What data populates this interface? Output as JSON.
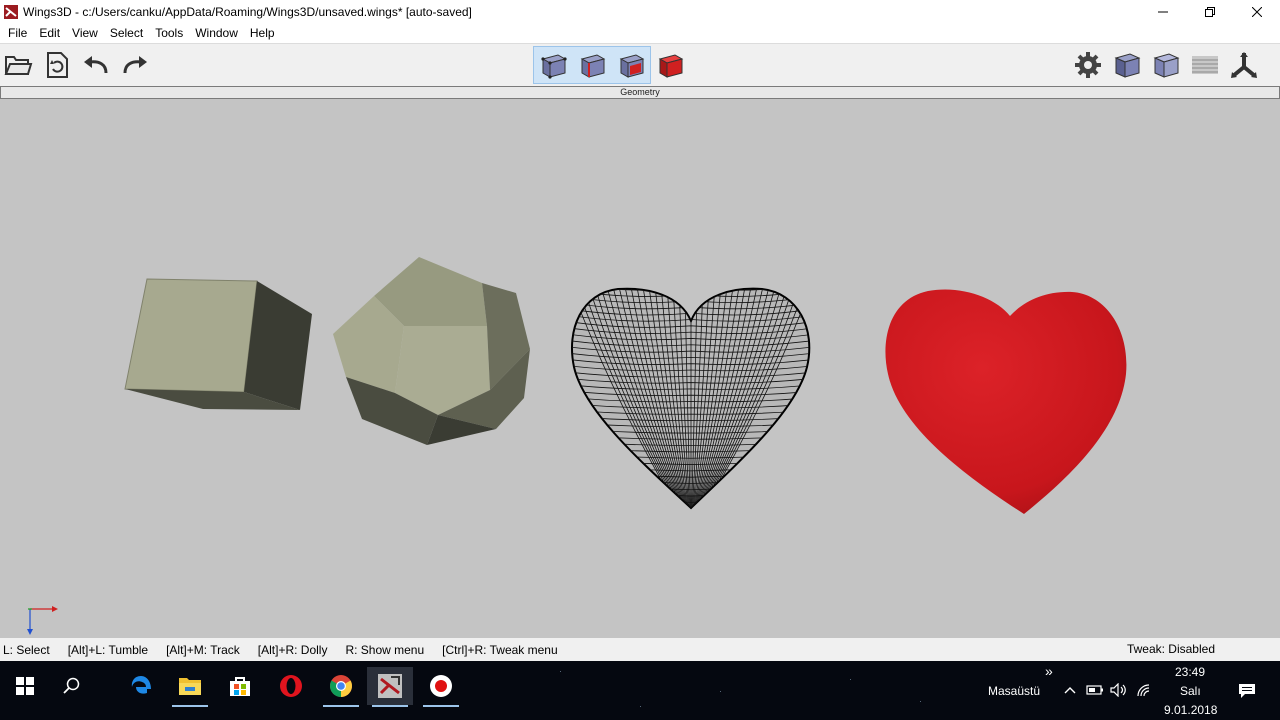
{
  "window": {
    "title": "Wings3D - c:/Users/canku/AppData/Roaming/Wings3D/unsaved.wings* [auto-saved]",
    "icon": "wings3d-app-icon",
    "controls": [
      "minimize-icon",
      "restore-icon",
      "close-icon"
    ]
  },
  "menubar": {
    "items": [
      "File",
      "Edit",
      "View",
      "Select",
      "Tools",
      "Window",
      "Help"
    ]
  },
  "toolbar": {
    "left_icons": [
      "open-folder-icon",
      "save-icon",
      "undo-icon",
      "redo-icon"
    ],
    "selection_modes": [
      "vertex-mode-icon",
      "edge-mode-icon",
      "face-mode-icon",
      "body-mode-icon"
    ],
    "right_icons": [
      "gear-icon",
      "smooth-preview-icon",
      "wireframe-icon",
      "ground-plane-icon",
      "axes-icon"
    ]
  },
  "geometry_bar": {
    "label": "Geometry"
  },
  "viewport": {
    "objects": [
      "cube",
      "dodecahedron",
      "wireframe-heart",
      "red-heart"
    ],
    "colors": {
      "background": "#c4c4c4",
      "object_light": "#a7a98f",
      "object_dark": "#3a3c33",
      "heart_red": "#c8161c"
    }
  },
  "statusbar": {
    "hints": [
      "L: Select",
      "[Alt]+L: Tumble",
      "[Alt]+M: Track",
      "[Alt]+R: Dolly",
      "R: Show menu",
      "[Ctrl]+R: Tweak menu"
    ],
    "tweak": "Tweak: Disabled"
  },
  "taskbar": {
    "apps": [
      "windows-start-icon",
      "search-icon",
      "edge-icon",
      "file-explorer-icon",
      "store-icon",
      "opera-icon",
      "chrome-icon",
      "wings3d-icon",
      "record-icon"
    ],
    "more_label": "»",
    "desktop_label": "Masaüstü",
    "clock_time": "23:49",
    "clock_day": "Salı",
    "clock_date": "9.01.2018"
  }
}
